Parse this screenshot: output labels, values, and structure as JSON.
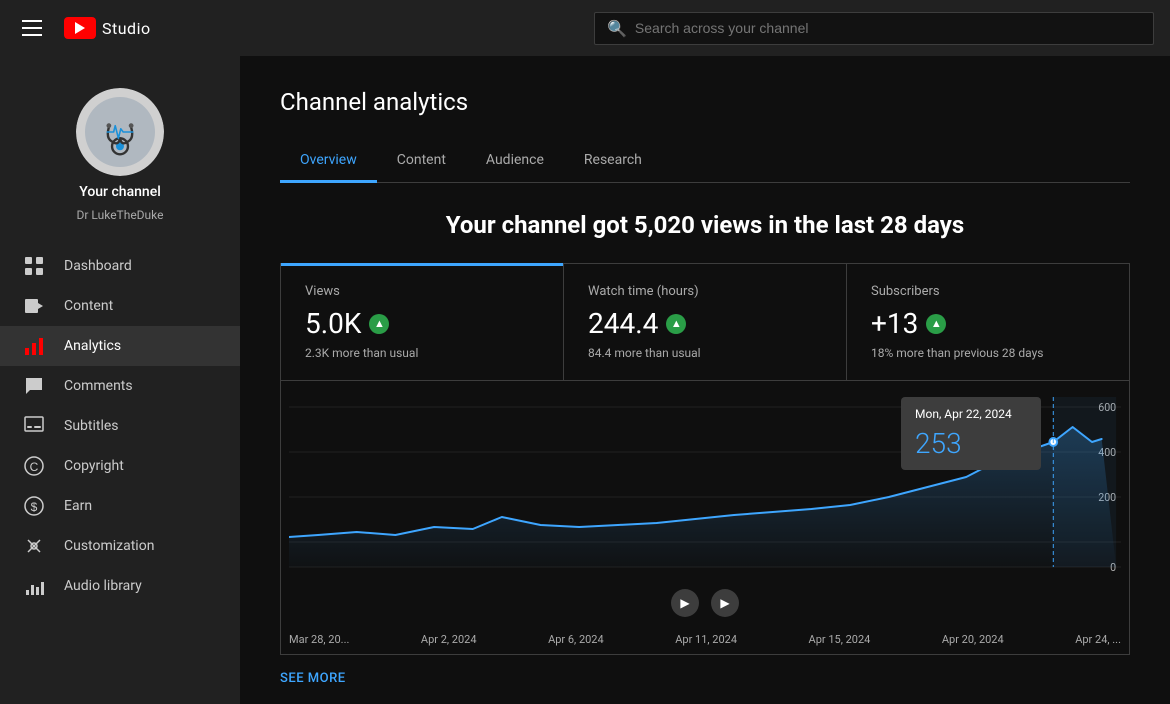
{
  "app": {
    "name": "Studio",
    "search_placeholder": "Search across your channel"
  },
  "channel": {
    "name": "Your channel",
    "handle": "Dr LukeTheDuke"
  },
  "sidebar": {
    "items": [
      {
        "id": "dashboard",
        "label": "Dashboard",
        "icon": "grid"
      },
      {
        "id": "content",
        "label": "Content",
        "icon": "video"
      },
      {
        "id": "analytics",
        "label": "Analytics",
        "icon": "chart",
        "active": true
      },
      {
        "id": "comments",
        "label": "Comments",
        "icon": "comment"
      },
      {
        "id": "subtitles",
        "label": "Subtitles",
        "icon": "subtitles"
      },
      {
        "id": "copyright",
        "label": "Copyright",
        "icon": "copyright"
      },
      {
        "id": "earn",
        "label": "Earn",
        "icon": "earn"
      },
      {
        "id": "customization",
        "label": "Customization",
        "icon": "customization"
      },
      {
        "id": "audio-library",
        "label": "Audio library",
        "icon": "audio"
      }
    ]
  },
  "analytics": {
    "page_title": "Channel analytics",
    "tabs": [
      {
        "id": "overview",
        "label": "Overview",
        "active": true
      },
      {
        "id": "content",
        "label": "Content"
      },
      {
        "id": "audience",
        "label": "Audience"
      },
      {
        "id": "research",
        "label": "Research"
      }
    ],
    "headline": "Your channel got 5,020 views in the last 28 days",
    "stats": [
      {
        "id": "views",
        "label": "Views",
        "value": "5.0K",
        "up": true,
        "subtitle": "2.3K more than usual",
        "active": true
      },
      {
        "id": "watch-time",
        "label": "Watch time (hours)",
        "value": "244.4",
        "up": true,
        "subtitle": "84.4 more than usual"
      },
      {
        "id": "subscribers",
        "label": "Subscribers",
        "value": "+13",
        "up": true,
        "subtitle": "18% more than previous 28 days"
      }
    ],
    "chart": {
      "tooltip": {
        "date": "Mon, Apr 22, 2024",
        "value": "253"
      },
      "y_labels": [
        "600",
        "400",
        "200",
        "0"
      ],
      "x_labels": [
        "Mar 28, 20...",
        "Apr 2, 2024",
        "Apr 6, 2024",
        "Apr 11, 2024",
        "Apr 15, 2024",
        "Apr 20, 2024",
        "Apr 24, ..."
      ]
    },
    "see_more": "SEE MORE"
  }
}
